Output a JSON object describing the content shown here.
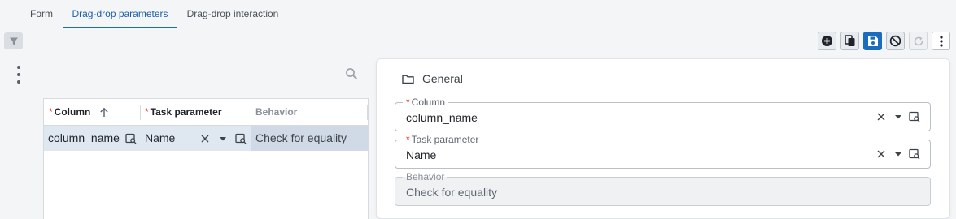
{
  "tabs": [
    {
      "label": "Form"
    },
    {
      "label": "Drag-drop parameters"
    },
    {
      "label": "Drag-drop interaction"
    }
  ],
  "active_tab": "Drag-drop parameters",
  "toolbar": {
    "icons": [
      "add-circle-icon",
      "copy-icon",
      "save-icon",
      "cancel-icon",
      "refresh-icon",
      "more-vertical-icon"
    ]
  },
  "grid": {
    "columns": [
      {
        "label": "Column",
        "required": "*",
        "sorted": "ascending"
      },
      {
        "label": "Task parameter",
        "required": "*"
      },
      {
        "label": "Behavior"
      }
    ],
    "rows": [
      {
        "column": "column_name",
        "task_parameter": "Name",
        "behavior": "Check for equality"
      }
    ]
  },
  "form": {
    "section_title": "General",
    "fields": [
      {
        "label": "Column",
        "required": "*",
        "value": "column_name"
      },
      {
        "label": "Task parameter",
        "required": "*",
        "value": "Name"
      },
      {
        "label": "Behavior",
        "value": "Check for equality"
      }
    ]
  },
  "colors": {
    "accent": "#1b6bbf",
    "required": "#d93025",
    "selected_row": "#dfe7f0"
  }
}
